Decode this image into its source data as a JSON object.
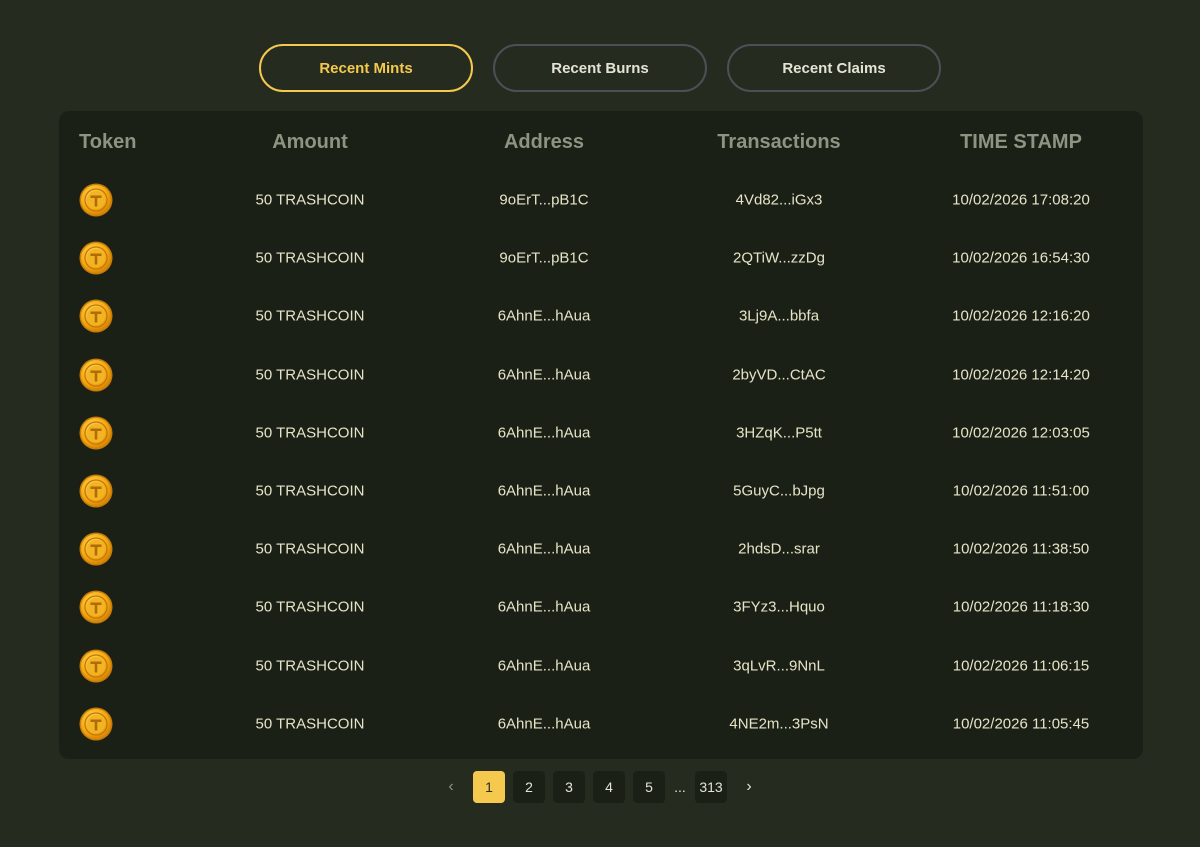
{
  "tabs": [
    {
      "label": "Recent Mints",
      "active": true
    },
    {
      "label": "Recent Burns",
      "active": false
    },
    {
      "label": "Recent Claims",
      "active": false
    }
  ],
  "table": {
    "headers": {
      "token": "Token",
      "amount": "Amount",
      "address": "Address",
      "transactions": "Transactions",
      "timestamp": "TIME STAMP"
    },
    "token_icon": "trashcoin-coin-icon",
    "rows": [
      {
        "amount": "50 TRASHCOIN",
        "address": "9oErT...pB1C",
        "tx": "4Vd82...iGx3",
        "ts": "10/02/2026 17:08:20"
      },
      {
        "amount": "50 TRASHCOIN",
        "address": "9oErT...pB1C",
        "tx": "2QTiW...zzDg",
        "ts": "10/02/2026 16:54:30"
      },
      {
        "amount": "50 TRASHCOIN",
        "address": "6AhnE...hAua",
        "tx": "3Lj9A...bbfa",
        "ts": "10/02/2026 12:16:20"
      },
      {
        "amount": "50 TRASHCOIN",
        "address": "6AhnE...hAua",
        "tx": "2byVD...CtAC",
        "ts": "10/02/2026 12:14:20"
      },
      {
        "amount": "50 TRASHCOIN",
        "address": "6AhnE...hAua",
        "tx": "3HZqK...P5tt",
        "ts": "10/02/2026 12:03:05"
      },
      {
        "amount": "50 TRASHCOIN",
        "address": "6AhnE...hAua",
        "tx": "5GuyC...bJpg",
        "ts": "10/02/2026 11:51:00"
      },
      {
        "amount": "50 TRASHCOIN",
        "address": "6AhnE...hAua",
        "tx": "2hdsD...srar",
        "ts": "10/02/2026 11:38:50"
      },
      {
        "amount": "50 TRASHCOIN",
        "address": "6AhnE...hAua",
        "tx": "3FYz3...Hquo",
        "ts": "10/02/2026 11:18:30"
      },
      {
        "amount": "50 TRASHCOIN",
        "address": "6AhnE...hAua",
        "tx": "3qLvR...9NnL",
        "ts": "10/02/2026 11:06:15"
      },
      {
        "amount": "50 TRASHCOIN",
        "address": "6AhnE...hAua",
        "tx": "4NE2m...3PsN",
        "ts": "10/02/2026 11:05:45"
      }
    ]
  },
  "pagination": {
    "prev_icon": "chevron-left-icon",
    "next_icon": "chevron-right-icon",
    "prev_glyph": "‹",
    "next_glyph": "›",
    "pages": [
      "1",
      "2",
      "3",
      "4",
      "5"
    ],
    "ellipsis": "...",
    "last_page": "313",
    "current": "1"
  },
  "colors": {
    "background": "#252b1f",
    "panel": "#1b2017",
    "accent": "#f4c94e",
    "header_text": "#8c9482",
    "cell_text": "#e6e4c7"
  }
}
